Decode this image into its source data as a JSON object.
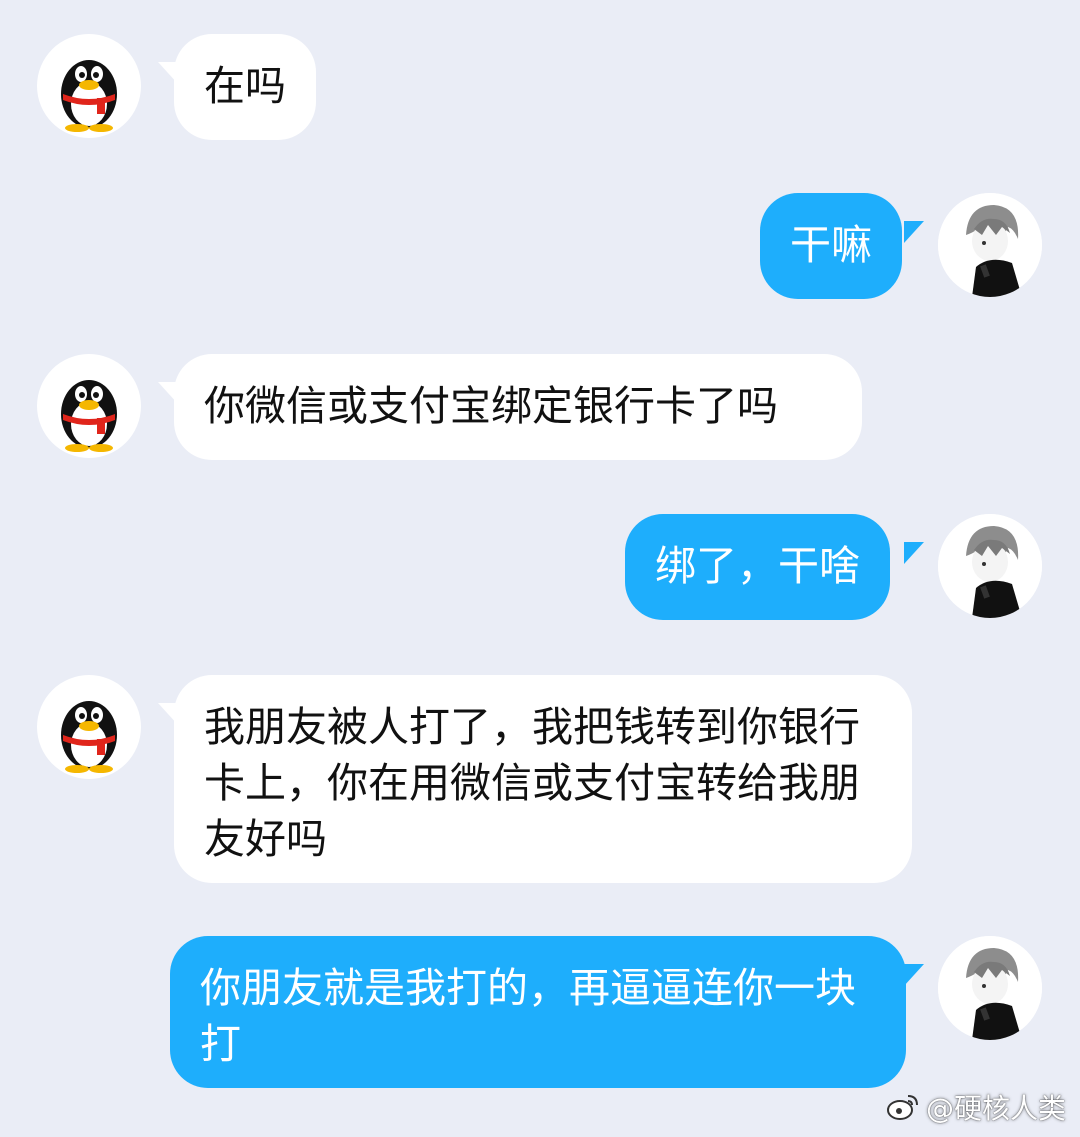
{
  "colors": {
    "background": "#eaedf6",
    "incoming_bubble": "#ffffff",
    "outgoing_bubble": "#1eaefc"
  },
  "messages": [
    {
      "side": "left",
      "avatar": "penguin-avatar-icon",
      "text": "在吗"
    },
    {
      "side": "right",
      "avatar": "anime-boy-avatar-icon",
      "text": "干嘛"
    },
    {
      "side": "left",
      "avatar": "penguin-avatar-icon",
      "text": "你微信或支付宝绑定银行卡了吗"
    },
    {
      "side": "right",
      "avatar": "anime-boy-avatar-icon",
      "text": "绑了，干啥"
    },
    {
      "side": "left",
      "avatar": "penguin-avatar-icon",
      "text": "我朋友被人打了，我把钱转到你银行卡上，你在用微信或支付宝转给我朋友好吗"
    },
    {
      "side": "right",
      "avatar": "anime-boy-avatar-icon",
      "text": "你朋友就是我打的，再逼逼连你一块打"
    }
  ],
  "watermark": {
    "icon": "weibo-icon",
    "text": "@硬核人类"
  }
}
